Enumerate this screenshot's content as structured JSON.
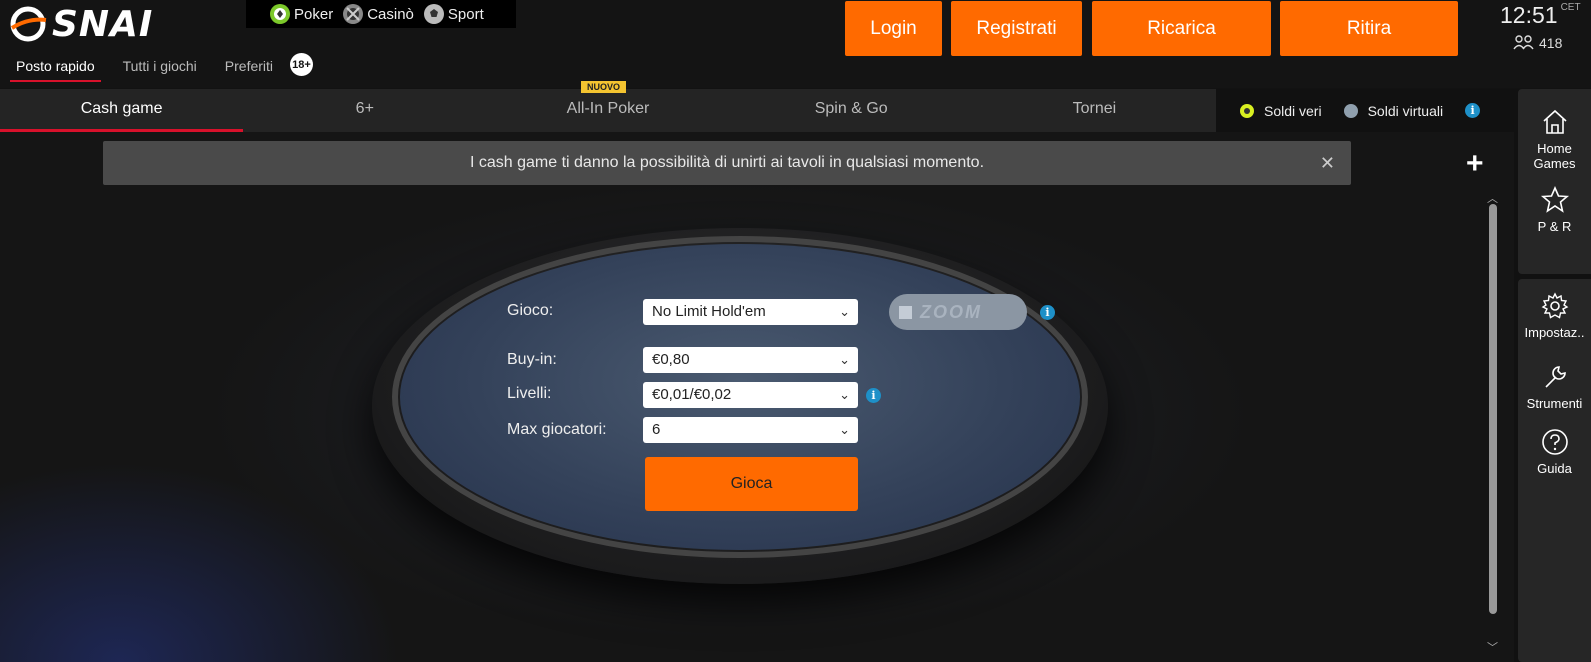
{
  "header": {
    "logo_text": "SNAI",
    "products": [
      {
        "label": "Poker",
        "icon": "poker-chip-icon"
      },
      {
        "label": "Casinò",
        "icon": "casino-icon"
      },
      {
        "label": "Sport",
        "icon": "football-icon"
      }
    ],
    "subnav": [
      "Posto rapido",
      "Tutti i giochi",
      "Preferiti"
    ],
    "age_badge": "18+",
    "buttons": {
      "login": "Login",
      "register": "Registrati",
      "topup": "Ricarica",
      "withdraw": "Ritira"
    },
    "clock": "12:51",
    "timezone": "CET",
    "players_online": "418",
    "accent_color": "#ff6a00"
  },
  "tabs": [
    {
      "label": "Cash game",
      "active": true
    },
    {
      "label": "6+"
    },
    {
      "label": "All-In Poker",
      "badge": "NUOVO"
    },
    {
      "label": "Spin & Go"
    },
    {
      "label": "Tornei"
    }
  ],
  "money": {
    "real": "Soldi veri",
    "virtual": "Soldi virtuali",
    "selected": "real"
  },
  "banner": {
    "text": "I cash game ti danno la possibilità di unirti ai tavoli in qualsiasi momento."
  },
  "form": {
    "game_label": "Gioco:",
    "game_value": "No Limit Hold'em",
    "zoom_label": "ZOOM",
    "buyin_label": "Buy-in:",
    "buyin_value": "€0,80",
    "levels_label": "Livelli:",
    "levels_value": "€0,01/€0,02",
    "max_label": "Max giocatori:",
    "max_value": "6",
    "play_button": "Gioca"
  },
  "sidebar": [
    {
      "label": "Home Games",
      "icon": "house-icon"
    },
    {
      "label": "P & R",
      "icon": "star-icon"
    },
    {
      "label": "Impostaz..",
      "icon": "gear-icon"
    },
    {
      "label": "Strumenti",
      "icon": "wrench-icon"
    },
    {
      "label": "Guida",
      "icon": "help-icon"
    }
  ]
}
